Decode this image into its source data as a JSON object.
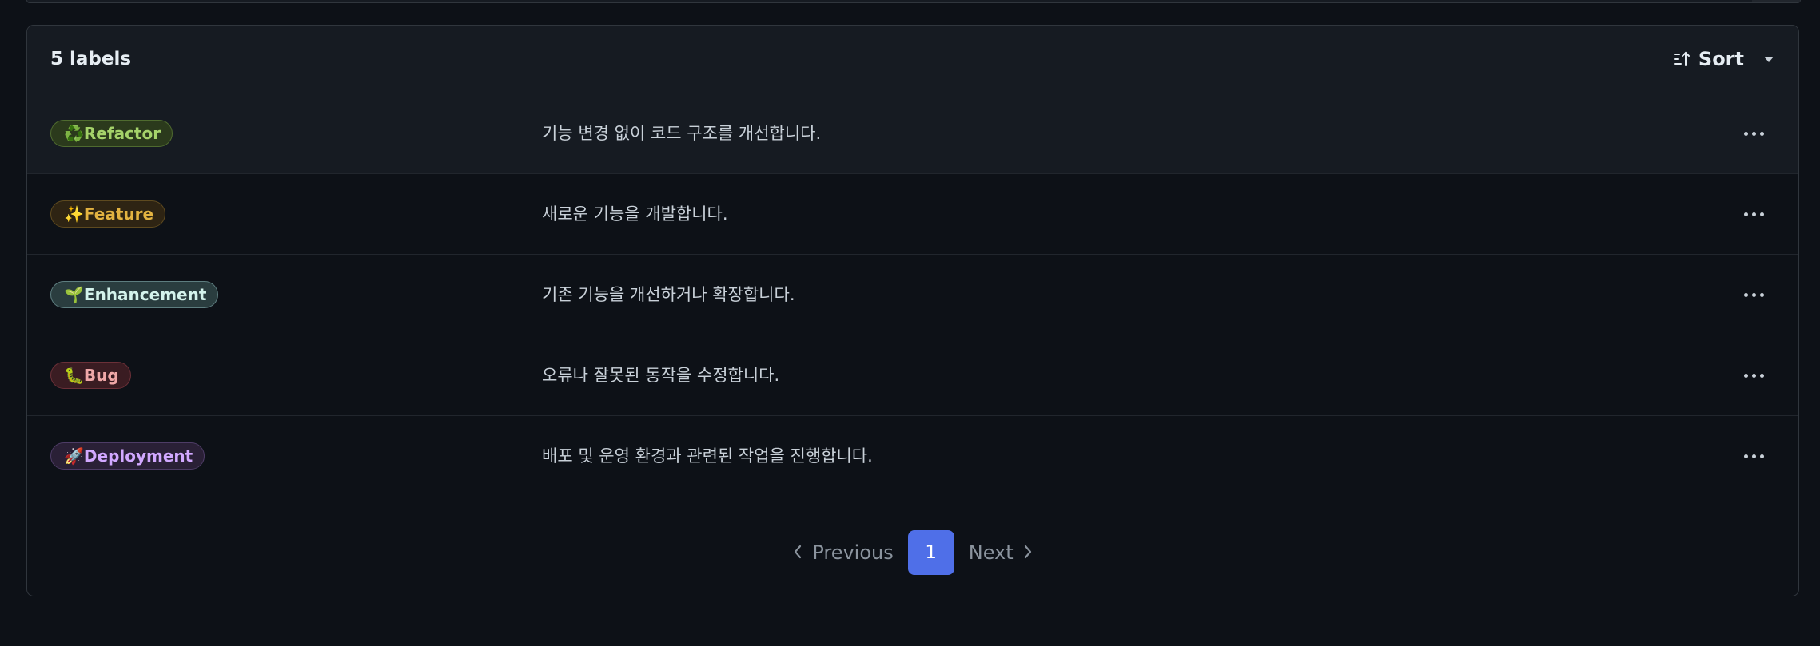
{
  "header": {
    "count_label": "5 labels",
    "sort_label": "Sort"
  },
  "labels": [
    {
      "emoji": "♻️",
      "name": "Refactor",
      "description": "기능 변경 없이 코드 구조를 개선합니다.",
      "text_color": "#a5d26a",
      "bg_color": "#2b3a1c",
      "border_color": "#4f6b2f"
    },
    {
      "emoji": "✨",
      "name": "Feature",
      "description": "새로운 기능을 개발합니다.",
      "text_color": "#e3b341",
      "bg_color": "#2e2413",
      "border_color": "#5e4a1f"
    },
    {
      "emoji": "🌱",
      "name": "Enhancement",
      "description": "기존 기능을 개선하거나 확장합니다.",
      "text_color": "#d4f3ec",
      "bg_color": "#2a3d3f",
      "border_color": "#5d7d7f"
    },
    {
      "emoji": "🐛",
      "name": "Bug",
      "description": "오류나 잘못된 동작을 수정합니다.",
      "text_color": "#f0a8a8",
      "bg_color": "#3a1c22",
      "border_color": "#6b3038"
    },
    {
      "emoji": "🚀",
      "name": "Deployment",
      "description": "배포 및 운영 환경과 관련된 작업을 진행합니다.",
      "text_color": "#d2a8ff",
      "bg_color": "#2a2036",
      "border_color": "#4e3c66"
    }
  ],
  "pagination": {
    "previous_label": "Previous",
    "current_page": "1",
    "next_label": "Next"
  },
  "colors": {
    "background": "#0d1117",
    "header_background": "#161b22",
    "border": "#30363d",
    "accent": "#4f6fe8"
  },
  "icons": {
    "sort": "sort-ascending-icon",
    "dropdown": "triangle-down-icon",
    "more": "kebab-horizontal-icon",
    "previous": "chevron-left-icon",
    "next": "chevron-right-icon"
  }
}
